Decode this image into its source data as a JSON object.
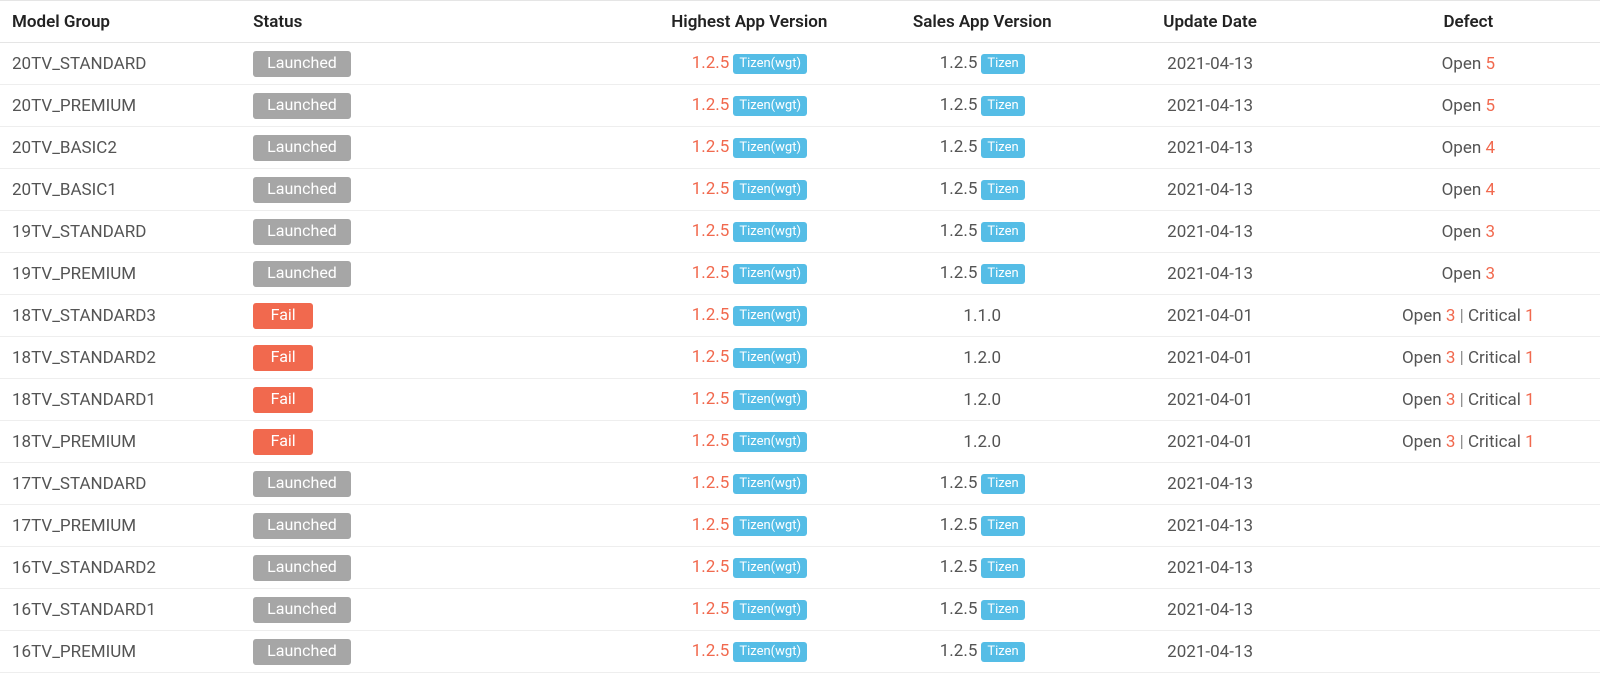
{
  "headers": {
    "model_group": "Model Group",
    "status": "Status",
    "highest_app_version": "Highest App Version",
    "sales_app_version": "Sales App Version",
    "update_date": "Update Date",
    "defect": "Defect"
  },
  "status_labels": {
    "launched": "Launched",
    "fail": "Fail"
  },
  "tags": {
    "tizen_wgt": "Tizen(wgt)",
    "tizen": "Tizen"
  },
  "defect_labels": {
    "open": "Open",
    "critical": "Critical",
    "sep": " | "
  },
  "rows": [
    {
      "model": "20TV_STANDARD",
      "status": "launched",
      "hav": "1.2.5",
      "hav_tag": "tizen_wgt",
      "sav": "1.2.5",
      "sav_tag": "tizen",
      "date": "2021-04-13",
      "open": 5
    },
    {
      "model": "20TV_PREMIUM",
      "status": "launched",
      "hav": "1.2.5",
      "hav_tag": "tizen_wgt",
      "sav": "1.2.5",
      "sav_tag": "tizen",
      "date": "2021-04-13",
      "open": 5
    },
    {
      "model": "20TV_BASIC2",
      "status": "launched",
      "hav": "1.2.5",
      "hav_tag": "tizen_wgt",
      "sav": "1.2.5",
      "sav_tag": "tizen",
      "date": "2021-04-13",
      "open": 4
    },
    {
      "model": "20TV_BASIC1",
      "status": "launched",
      "hav": "1.2.5",
      "hav_tag": "tizen_wgt",
      "sav": "1.2.5",
      "sav_tag": "tizen",
      "date": "2021-04-13",
      "open": 4
    },
    {
      "model": "19TV_STANDARD",
      "status": "launched",
      "hav": "1.2.5",
      "hav_tag": "tizen_wgt",
      "sav": "1.2.5",
      "sav_tag": "tizen",
      "date": "2021-04-13",
      "open": 3
    },
    {
      "model": "19TV_PREMIUM",
      "status": "launched",
      "hav": "1.2.5",
      "hav_tag": "tizen_wgt",
      "sav": "1.2.5",
      "sav_tag": "tizen",
      "date": "2021-04-13",
      "open": 3
    },
    {
      "model": "18TV_STANDARD3",
      "status": "fail",
      "hav": "1.2.5",
      "hav_tag": "tizen_wgt",
      "sav": "1.1.0",
      "sav_tag": null,
      "date": "2021-04-01",
      "open": 3,
      "critical": 1
    },
    {
      "model": "18TV_STANDARD2",
      "status": "fail",
      "hav": "1.2.5",
      "hav_tag": "tizen_wgt",
      "sav": "1.2.0",
      "sav_tag": null,
      "date": "2021-04-01",
      "open": 3,
      "critical": 1
    },
    {
      "model": "18TV_STANDARD1",
      "status": "fail",
      "hav": "1.2.5",
      "hav_tag": "tizen_wgt",
      "sav": "1.2.0",
      "sav_tag": null,
      "date": "2021-04-01",
      "open": 3,
      "critical": 1
    },
    {
      "model": "18TV_PREMIUM",
      "status": "fail",
      "hav": "1.2.5",
      "hav_tag": "tizen_wgt",
      "sav": "1.2.0",
      "sav_tag": null,
      "date": "2021-04-01",
      "open": 3,
      "critical": 1
    },
    {
      "model": "17TV_STANDARD",
      "status": "launched",
      "hav": "1.2.5",
      "hav_tag": "tizen_wgt",
      "sav": "1.2.5",
      "sav_tag": "tizen",
      "date": "2021-04-13"
    },
    {
      "model": "17TV_PREMIUM",
      "status": "launched",
      "hav": "1.2.5",
      "hav_tag": "tizen_wgt",
      "sav": "1.2.5",
      "sav_tag": "tizen",
      "date": "2021-04-13"
    },
    {
      "model": "16TV_STANDARD2",
      "status": "launched",
      "hav": "1.2.5",
      "hav_tag": "tizen_wgt",
      "sav": "1.2.5",
      "sav_tag": "tizen",
      "date": "2021-04-13"
    },
    {
      "model": "16TV_STANDARD1",
      "status": "launched",
      "hav": "1.2.5",
      "hav_tag": "tizen_wgt",
      "sav": "1.2.5",
      "sav_tag": "tizen",
      "date": "2021-04-13"
    },
    {
      "model": "16TV_PREMIUM",
      "status": "launched",
      "hav": "1.2.5",
      "hav_tag": "tizen_wgt",
      "sav": "1.2.5",
      "sav_tag": "tizen",
      "date": "2021-04-13"
    }
  ]
}
